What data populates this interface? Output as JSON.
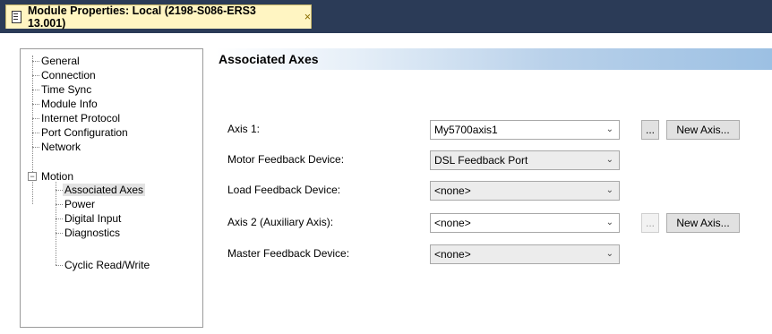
{
  "tab": {
    "title": "Module Properties: Local (2198-S086-ERS3 13.001)",
    "close": "×"
  },
  "tree": {
    "items": [
      "General",
      "Connection",
      "Time Sync",
      "Module Info",
      "Internet Protocol",
      "Port Configuration",
      "Network",
      "Motion"
    ],
    "motion_expander": "−",
    "motion_children": [
      "Associated Axes",
      "Power",
      "Digital Input",
      "Diagnostics",
      "Cyclic Read/Write"
    ],
    "selected": "Associated Axes"
  },
  "panel": {
    "title": "Associated Axes",
    "fields": [
      {
        "label": "Axis 1:",
        "value": "My5700axis1"
      },
      {
        "label": "Motor Feedback Device:",
        "value": "DSL Feedback Port"
      },
      {
        "label": "Load Feedback Device:",
        "value": "<none>"
      },
      {
        "label": "Axis 2  (Auxiliary Axis):",
        "value": "<none>"
      },
      {
        "label": "Master Feedback Device:",
        "value": "<none>"
      }
    ],
    "dropdown_icon": "chevron-down-icon",
    "browse_label": "...",
    "new_axis_label": "New Axis..."
  }
}
